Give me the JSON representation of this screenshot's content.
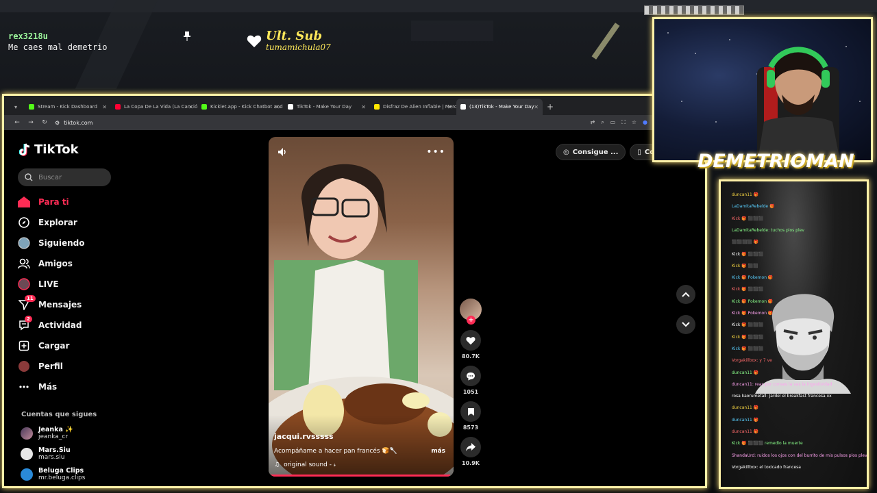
{
  "overlay": {
    "chat_user": "rex3218u",
    "chat_message": "Me caes mal demetrio",
    "ult_sub_title": "Ult. Sub",
    "ult_sub_name": "tumamichula07",
    "streamer_name": "DEMETRIOMAN",
    "accent_color": "#fff1a8"
  },
  "browser": {
    "tabs": [
      {
        "title": "Stream - Kick Dashboard",
        "color": "#53fc18"
      },
      {
        "title": "La Copa De La Vida (La Canción...",
        "color": "#ff0033"
      },
      {
        "title": "Kicklet.app - Kick Chatbot and ...",
        "color": "#53fc18"
      },
      {
        "title": "TikTok - Make Your Day",
        "color": "#ffffff"
      },
      {
        "title": "Disfraz De Alien Inflable | Merc...",
        "color": "#ffe600"
      },
      {
        "title": "(13)TikTok - Make Your Day",
        "color": "#ffffff"
      }
    ],
    "url": "tiktok.com"
  },
  "tiktok": {
    "logo": "TikTok",
    "search_placeholder": "Buscar",
    "nav": [
      {
        "label": "Para ti",
        "icon": "home-icon"
      },
      {
        "label": "Explorar",
        "icon": "compass-icon"
      },
      {
        "label": "Siguiendo",
        "icon": "following-avatar-icon"
      },
      {
        "label": "Amigos",
        "icon": "friends-icon"
      },
      {
        "label": "LIVE",
        "icon": "live-avatar-icon"
      },
      {
        "label": "Mensajes",
        "icon": "messages-icon",
        "badge": "11"
      },
      {
        "label": "Actividad",
        "icon": "activity-icon",
        "badge": "2"
      },
      {
        "label": "Cargar",
        "icon": "upload-icon"
      },
      {
        "label": "Perfil",
        "icon": "profile-icon"
      },
      {
        "label": "Más",
        "icon": "more-icon"
      }
    ],
    "following_title": "Cuentas que sigues",
    "following": [
      {
        "name": "Jeanka ✨",
        "handle": "jeanka_cr"
      },
      {
        "name": "Mars.Siu",
        "handle": "mars.siu"
      },
      {
        "name": "Beluga Clips",
        "handle": "mr.beluga.clips"
      }
    ],
    "top_buttons": [
      "Consigue ...",
      "Consegui"
    ],
    "video": {
      "author": "jacqui.rvsssss",
      "caption": "Acompáñame a hacer pan francés 🍞🥄",
      "more": "más",
      "sound": "original sound - 𝓈",
      "progress": 0.98
    },
    "actions": {
      "likes": "80.7K",
      "comments": "1051",
      "saves": "8573",
      "shares": "10.9K"
    }
  },
  "side_chat": [
    "duncan11 🎁",
    "LaDamitaRebelde 🎁",
    "Kick 🎁 ⬛⬛⬛",
    "LaDamitaRebelde: tuchos plos plev",
    "⬛⬛⬛⬛ 🎁",
    "Kick 🎁 ⬛⬛⬛",
    "Kick 🎁 ⬛⬛",
    "Kick 🎁 Pokemon 🎁",
    "Kick 🎁 ⬛⬛⬛",
    "Kick 🎁 Pokemon 🎁",
    "Kick 🎁 Pokemon 🎁",
    "Kick 🎁 ⬛⬛⬛",
    "Kick 🎁 ⬛⬛⬛",
    "Kick 🎁 ⬛⬛⬛",
    "Vorgakillbox: y 7 ve",
    "duncan11 🎁",
    "duncan11: reas por conses la vas la ingestividad",
    "rosa kaorumetall: Jardel el breakfast francesa xx",
    "duncan11 🎁",
    "duncan11 🎁",
    "duncan11 🎁",
    "Kick 🎁 ⬛⬛⬛ remedio la muerte",
    "ShandaUrd: ruidos los ojos con del burrito de mis pulsos plos plev",
    "Vorgakillbox: el toxicado francesa"
  ]
}
